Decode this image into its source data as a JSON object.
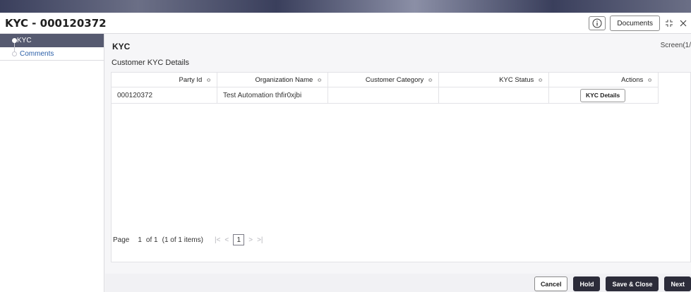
{
  "window": {
    "title": "KYC - 000120372",
    "documents_label": "Documents"
  },
  "sidebar": {
    "items": [
      {
        "label": "KYC",
        "active": true
      },
      {
        "label": "Comments",
        "active": false
      }
    ]
  },
  "main": {
    "section_title": "KYC",
    "screen_label": "Screen(1/",
    "subtitle": "Customer KYC Details",
    "table": {
      "headers": [
        "Party Id",
        "Organization Name",
        "Customer Category",
        "KYC Status",
        "Actions"
      ],
      "rows": [
        {
          "party_id": "000120372",
          "org_name": "Test Automation thfir0xjbi",
          "category": "",
          "status": "",
          "action_label": "KYC Details"
        }
      ]
    },
    "pager": {
      "page_label": "Page",
      "current": "1",
      "of_text": "of 1",
      "items_text": "(1 of 1 items)",
      "first": "|<",
      "prev": "<",
      "next": ">",
      "last": ">|"
    }
  },
  "footer": {
    "cancel": "Cancel",
    "hold": "Hold",
    "save_close": "Save & Close",
    "next": "Next"
  },
  "colors": {
    "active_nav": "#565a70",
    "primary_button": "#2c2c3a",
    "link": "#2a5fa8"
  }
}
